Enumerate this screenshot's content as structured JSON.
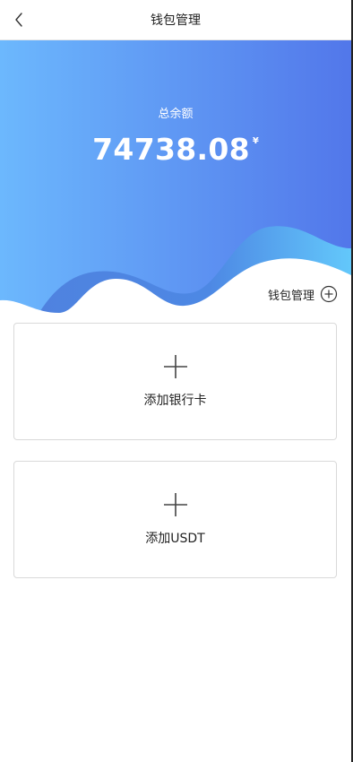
{
  "header": {
    "title": "钱包管理",
    "back_icon": "chevron-left-icon"
  },
  "banner": {
    "gradient_start": "#6cb8fd",
    "gradient_end": "#5277ea",
    "balance_label": "总余额",
    "balance_amount": "74738.08",
    "currency_symbol": "¥"
  },
  "wallet_manage": {
    "label": "钱包管理",
    "icon": "add-circle-icon"
  },
  "cards": [
    {
      "icon": "plus-icon",
      "label": "添加银行卡"
    },
    {
      "icon": "plus-icon",
      "label": "添加USDT"
    }
  ]
}
